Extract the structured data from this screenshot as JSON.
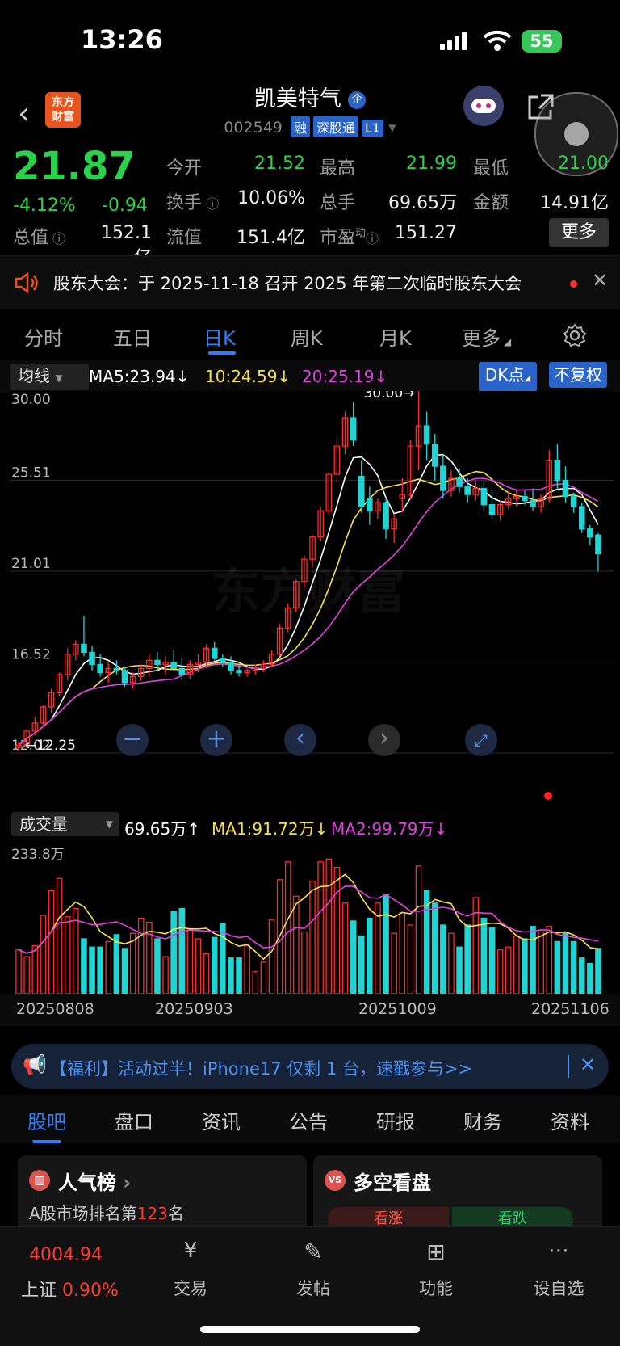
{
  "status": {
    "time": "13:26",
    "battery": "55"
  },
  "header": {
    "name": "凯美特气",
    "badge": "企",
    "code": "002549",
    "tags": [
      "融",
      "深股通",
      "L1"
    ],
    "logo": "东方\n财富"
  },
  "quote": {
    "price": "21.87",
    "change_pct": "-4.12%",
    "change": "-0.94",
    "open_label": "今开",
    "open": "21.52",
    "high_label": "最高",
    "high": "21.99",
    "low_label": "最低",
    "low": "21.00",
    "turnover_label": "换手",
    "turnover": "10.06%",
    "vol_label": "总手",
    "vol": "69.65万",
    "amount_label": "金额",
    "amount": "14.91亿",
    "mcap_label": "总值",
    "mcap": "152.1亿",
    "float_label": "流值",
    "float": "151.4亿",
    "pe_label": "市盈",
    "pe_sup": "动",
    "pe": "151.27",
    "more": "更多"
  },
  "notice": {
    "text": "股东大会：于 2025-11-18 召开 2025 年第二次临时股东大会"
  },
  "tabs": [
    "分时",
    "五日",
    "日K",
    "周K",
    "月K",
    "更多"
  ],
  "active_tab": "日K",
  "kbar": {
    "type": "均线",
    "ma5": "MA5:23.94",
    "ma10": "10:24.59",
    "ma20": "20:25.19",
    "dk": "DK点",
    "fq": "不复权"
  },
  "vbar": {
    "type": "成交量",
    "vol": "69.65万",
    "ma1": "MA1:91.72万",
    "ma2": "MA2:99.79万"
  },
  "chart_data": {
    "type": "candlestick",
    "y_ticks": [
      "30.00",
      "25.51",
      "21.01",
      "16.52",
      "12.02"
    ],
    "ylim": [
      12.02,
      30.0
    ],
    "annotations": {
      "high": "30.00",
      "low": "12.25"
    },
    "vol_max_label": "233.8万",
    "dates": [
      "20250808",
      "20250903",
      "20251009",
      "20251106"
    ],
    "ohlc": [
      [
        12.3,
        12.6,
        12.1,
        12.4
      ],
      [
        12.4,
        13.2,
        12.3,
        13.1
      ],
      [
        13.1,
        13.8,
        12.9,
        13.5
      ],
      [
        13.5,
        14.4,
        13.3,
        14.3
      ],
      [
        14.3,
        15.2,
        14.0,
        15.0
      ],
      [
        15.0,
        16.0,
        14.8,
        15.9
      ],
      [
        15.9,
        17.2,
        15.6,
        16.9
      ],
      [
        16.9,
        17.6,
        16.6,
        17.4
      ],
      [
        17.4,
        18.8,
        16.8,
        17.0
      ],
      [
        17.0,
        17.3,
        16.1,
        16.4
      ],
      [
        16.4,
        16.9,
        15.8,
        16.0
      ],
      [
        16.0,
        16.5,
        15.5,
        16.2
      ],
      [
        16.2,
        16.6,
        15.9,
        16.1
      ],
      [
        16.1,
        16.3,
        15.3,
        15.5
      ],
      [
        15.5,
        16.0,
        15.2,
        15.8
      ],
      [
        15.8,
        16.4,
        15.6,
        16.2
      ],
      [
        16.2,
        16.9,
        15.8,
        16.6
      ],
      [
        16.6,
        17.0,
        16.1,
        16.4
      ],
      [
        16.4,
        16.8,
        15.9,
        16.5
      ],
      [
        16.5,
        17.1,
        16.2,
        16.2
      ],
      [
        16.2,
        16.7,
        15.6,
        15.9
      ],
      [
        15.9,
        16.6,
        15.7,
        16.4
      ],
      [
        16.4,
        16.9,
        16.0,
        16.5
      ],
      [
        16.5,
        17.4,
        16.2,
        17.2
      ],
      [
        17.2,
        17.5,
        16.6,
        16.7
      ],
      [
        16.7,
        16.9,
        16.3,
        16.5
      ],
      [
        16.5,
        16.8,
        15.9,
        16.1
      ],
      [
        16.1,
        16.4,
        15.8,
        16.0
      ],
      [
        16.0,
        16.2,
        15.8,
        16.1
      ],
      [
        16.1,
        16.4,
        15.9,
        16.2
      ],
      [
        16.2,
        16.6,
        16.0,
        16.4
      ],
      [
        16.4,
        17.1,
        16.3,
        16.9
      ],
      [
        16.9,
        18.4,
        16.8,
        18.2
      ],
      [
        18.2,
        19.4,
        18.0,
        19.2
      ],
      [
        19.2,
        20.6,
        19.0,
        20.5
      ],
      [
        20.5,
        21.8,
        20.2,
        21.6
      ],
      [
        21.6,
        22.8,
        21.2,
        22.7
      ],
      [
        22.7,
        24.2,
        22.5,
        24.0
      ],
      [
        24.0,
        25.9,
        23.8,
        25.8
      ],
      [
        25.8,
        27.6,
        25.4,
        27.2
      ],
      [
        27.2,
        28.9,
        26.8,
        28.6
      ],
      [
        28.6,
        29.4,
        27.2,
        27.5
      ],
      [
        25.7,
        26.5,
        23.9,
        24.2
      ],
      [
        24.6,
        25.2,
        23.3,
        24.0
      ],
      [
        24.0,
        24.6,
        23.6,
        24.4
      ],
      [
        24.4,
        24.6,
        22.6,
        23.1
      ],
      [
        23.1,
        23.8,
        22.4,
        23.6
      ],
      [
        24.6,
        25.6,
        23.9,
        24.8
      ],
      [
        24.8,
        27.5,
        24.6,
        27.2
      ],
      [
        27.2,
        30.0,
        26.0,
        28.2
      ],
      [
        28.2,
        28.9,
        26.5,
        27.3
      ],
      [
        27.3,
        27.8,
        25.5,
        26.2
      ],
      [
        26.2,
        26.8,
        24.6,
        25.0
      ],
      [
        25.0,
        26.0,
        24.7,
        25.6
      ],
      [
        25.6,
        26.1,
        24.9,
        25.2
      ],
      [
        25.2,
        25.6,
        24.4,
        24.8
      ],
      [
        24.8,
        25.5,
        24.5,
        25.1
      ],
      [
        25.1,
        25.5,
        24.0,
        24.3
      ],
      [
        24.3,
        25.0,
        23.6,
        23.8
      ],
      [
        23.8,
        24.5,
        23.5,
        24.3
      ],
      [
        24.3,
        25.0,
        24.1,
        24.6
      ],
      [
        24.6,
        25.1,
        24.2,
        24.7
      ],
      [
        24.7,
        25.0,
        24.3,
        24.5
      ],
      [
        24.5,
        25.1,
        24.0,
        24.2
      ],
      [
        24.2,
        24.8,
        23.9,
        24.6
      ],
      [
        24.6,
        27.0,
        24.4,
        26.5
      ],
      [
        26.5,
        27.3,
        25.1,
        25.5
      ],
      [
        25.5,
        26.2,
        24.4,
        24.7
      ],
      [
        24.7,
        24.9,
        23.9,
        24.2
      ],
      [
        24.2,
        24.4,
        22.9,
        23.1
      ],
      [
        23.1,
        23.3,
        22.3,
        22.7
      ],
      [
        22.8,
        22.9,
        21.0,
        21.87
      ]
    ],
    "volume_relative": [
      0.32,
      0.27,
      0.35,
      0.57,
      0.75,
      0.84,
      0.56,
      0.62,
      0.4,
      0.34,
      0.34,
      0.38,
      0.43,
      0.33,
      0.44,
      0.55,
      0.52,
      0.4,
      0.27,
      0.6,
      0.62,
      0.47,
      0.4,
      0.29,
      0.41,
      0.51,
      0.26,
      0.26,
      0.35,
      0.16,
      0.23,
      0.54,
      0.83,
      0.96,
      0.71,
      0.45,
      0.82,
      0.96,
      0.98,
      0.92,
      0.66,
      0.53,
      0.42,
      0.55,
      0.66,
      0.72,
      0.44,
      0.59,
      0.5,
      0.93,
      0.75,
      0.66,
      0.5,
      0.44,
      0.34,
      0.5,
      0.7,
      0.55,
      0.48,
      0.32,
      0.34,
      0.42,
      0.4,
      0.49,
      0.45,
      0.49,
      0.38,
      0.44,
      0.38,
      0.26,
      0.22,
      0.33
    ]
  },
  "ad": {
    "text": "【福利】活动过半！iPhone17 仅剩 1 台，速戳参与>>"
  },
  "bottom_tabs": [
    "股吧",
    "盘口",
    "资讯",
    "公告",
    "研报",
    "财务",
    "资料"
  ],
  "cards": {
    "popular_title": "人气榜",
    "popular_sub_pre": "A股市场排名第",
    "popular_rank": "123",
    "popular_sub_post": "名",
    "duokong": "多空看盘",
    "up": "看涨",
    "down": "看跌"
  },
  "index": {
    "value": "4004.94",
    "name": "上证",
    "pct": "0.90%"
  },
  "nav": [
    "交易",
    "发帖",
    "功能",
    "设自选"
  ]
}
